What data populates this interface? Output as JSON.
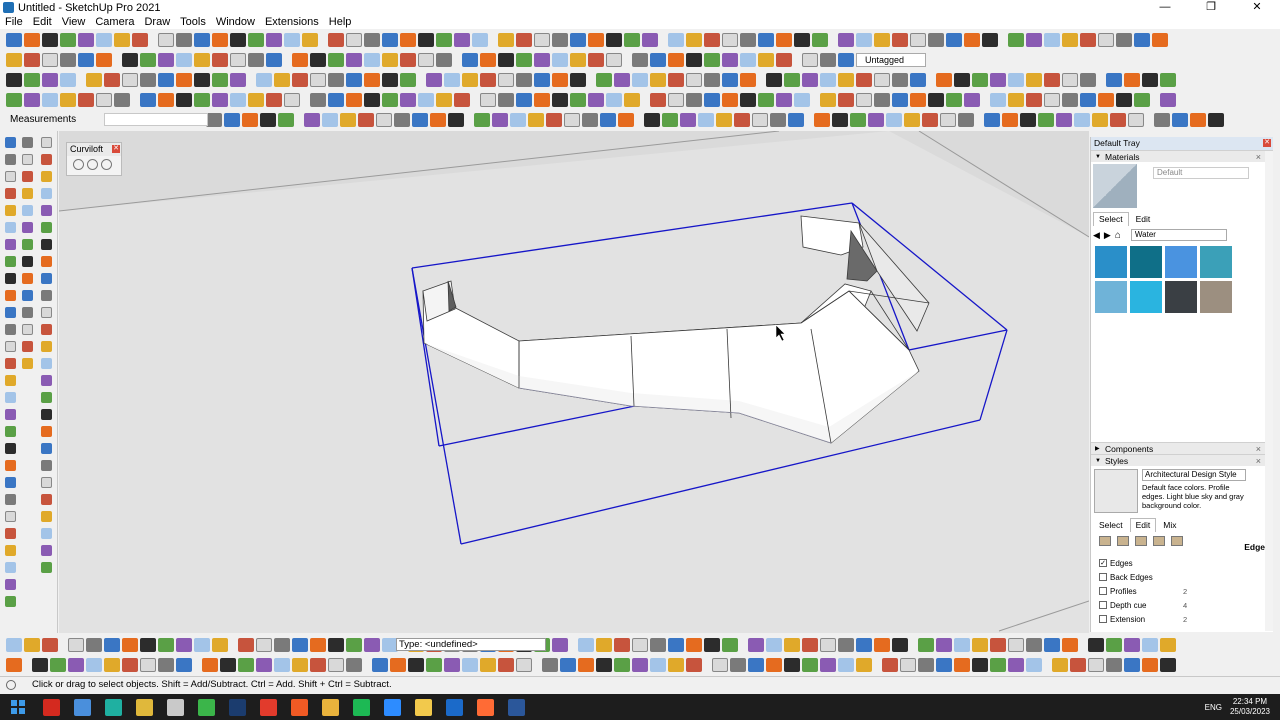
{
  "window": {
    "title": "Untitled - SketchUp Pro 2021"
  },
  "menu": [
    "File",
    "Edit",
    "View",
    "Camera",
    "Draw",
    "Tools",
    "Window",
    "Extensions",
    "Help"
  ],
  "toolbar": {
    "tag_value": "Untagged",
    "measurements_label": "Measurements",
    "type_value": "Type: <undefined>"
  },
  "curviloft": {
    "title": "Curviloft"
  },
  "tray": {
    "title": "Default Tray",
    "materials": {
      "header": "Materials",
      "current": "Default",
      "tabs": [
        "Select",
        "Edit"
      ],
      "library": "Water",
      "swatch_colors": [
        "#2a8fc9",
        "#0f6f88",
        "#4a93e0",
        "#3ba0b8",
        "#6fb3d8",
        "#2ab4e0",
        "#3a3f44",
        "#9c8f80"
      ]
    },
    "components": {
      "header": "Components"
    },
    "styles": {
      "header": "Styles",
      "name": "Architectural Design Style",
      "description": "Default face colors. Profile edges. Light blue sky and gray background color.",
      "tabs": [
        "Select",
        "Edit",
        "Mix"
      ],
      "section": "Edge",
      "options": [
        {
          "label": "Edges",
          "checked": true,
          "value": ""
        },
        {
          "label": "Back Edges",
          "checked": false,
          "value": ""
        },
        {
          "label": "Profiles",
          "checked": false,
          "value": "2"
        },
        {
          "label": "Depth cue",
          "checked": false,
          "value": "4"
        },
        {
          "label": "Extension",
          "checked": false,
          "value": "2"
        }
      ]
    }
  },
  "status": {
    "message": "Click or drag to select objects. Shift = Add/Subtract. Ctrl = Add. Shift + Ctrl = Subtract."
  },
  "taskbar": {
    "language": "ENG",
    "time": "22:34 PM",
    "date": "25/03/2023",
    "apps": [
      {
        "name": "adobe-icon",
        "color": "#d42a1f"
      },
      {
        "name": "browser-icon",
        "color": "#4a8fdc"
      },
      {
        "name": "clip-icon",
        "color": "#1fb0a1"
      },
      {
        "name": "files-icon",
        "color": "#e0b83b"
      },
      {
        "name": "tasks-icon",
        "color": "#c9c9c9"
      },
      {
        "name": "camtasia-icon",
        "color": "#3bb54a"
      },
      {
        "name": "photoshop-icon",
        "color": "#1b3c6e"
      },
      {
        "name": "sketchup-icon",
        "color": "#e23b2c"
      },
      {
        "name": "brave-icon",
        "color": "#f15a24"
      },
      {
        "name": "chrome-icon",
        "color": "#e9b33c"
      },
      {
        "name": "spotify-icon",
        "color": "#1db954"
      },
      {
        "name": "zoom-icon",
        "color": "#2d8cff"
      },
      {
        "name": "explorer-icon",
        "color": "#f2c94c"
      },
      {
        "name": "mail-icon",
        "color": "#1b6ac9"
      },
      {
        "name": "canva-icon",
        "color": "#ff6b35"
      },
      {
        "name": "sketchup-active-icon",
        "color": "#2b579a"
      }
    ]
  }
}
